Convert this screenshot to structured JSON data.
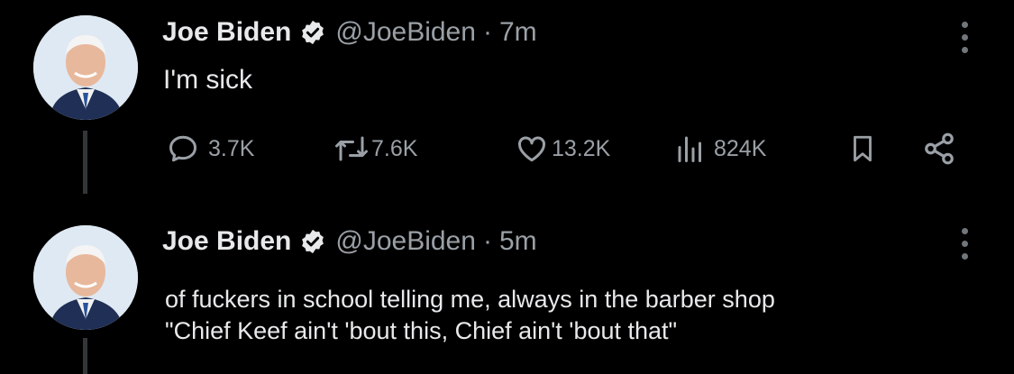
{
  "colors": {
    "background": "#000000",
    "text": "#e7e9ea",
    "muted": "#9aa0a6",
    "verified": "#e7e9ea"
  },
  "tweets": [
    {
      "name": "Joe Biden",
      "handle": "@JoeBiden",
      "separator": "·",
      "time": "7m",
      "text": "I'm sick",
      "actions": {
        "replies": "3.7K",
        "reposts": "7.6K",
        "likes": "13.2K",
        "views": "824K"
      },
      "icons": [
        "reply-icon",
        "repost-icon",
        "like-icon",
        "views-icon",
        "bookmark-icon",
        "share-icon"
      ]
    },
    {
      "name": "Joe Biden",
      "handle": "@JoeBiden",
      "separator": "·",
      "time": "5m",
      "text_lines": [
        "of fuckers in school telling me, always in the barber shop",
        "\"Chief Keef ain't 'bout this, Chief ain't 'bout that\""
      ]
    }
  ]
}
